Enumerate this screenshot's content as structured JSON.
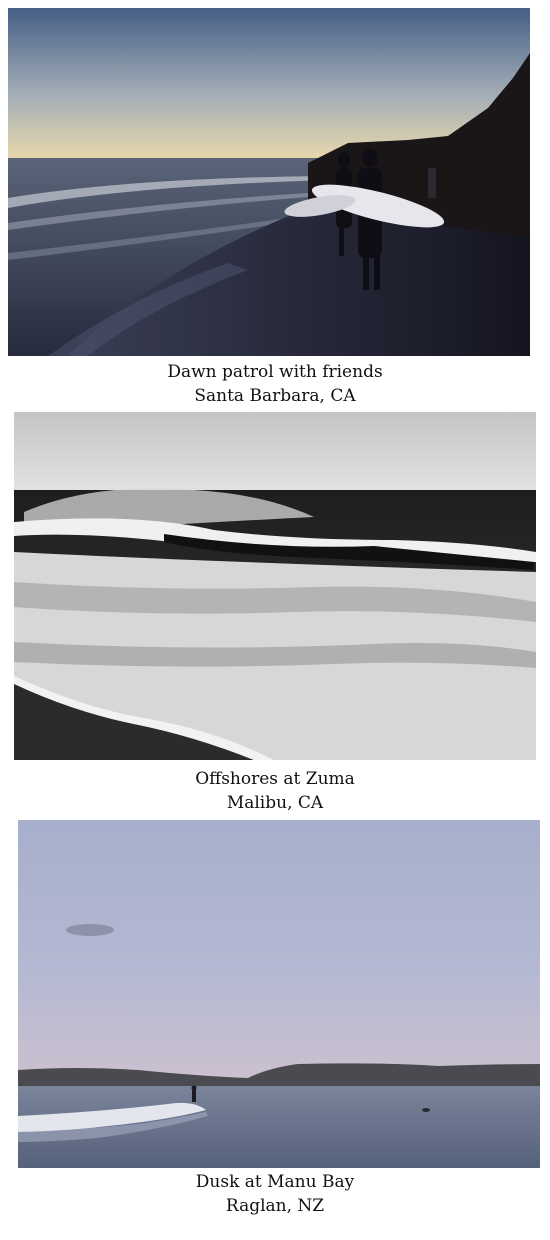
{
  "photos": [
    {
      "caption_title": "Dawn patrol with friends",
      "caption_location": "Santa Barbara, CA",
      "palette": {
        "sky_top": "#4a6389",
        "sky_bottom": "#efdcae",
        "sea": "#2c3346",
        "sand": "#1b1b26"
      }
    },
    {
      "caption_title": "Offshores at Zuma",
      "caption_location": "Malibu, CA",
      "palette": {
        "sky": "#cfcfcf",
        "sea": "#2a2a2a",
        "foam": "#e8e8e8"
      }
    },
    {
      "caption_title": "Dusk at Manu Bay",
      "caption_location": "Raglan, NZ",
      "palette": {
        "sky_top": "#aab3cf",
        "sky_bottom": "#c9bfcf",
        "hills": "#4a4a4e",
        "sea": "#65718a"
      }
    }
  ]
}
